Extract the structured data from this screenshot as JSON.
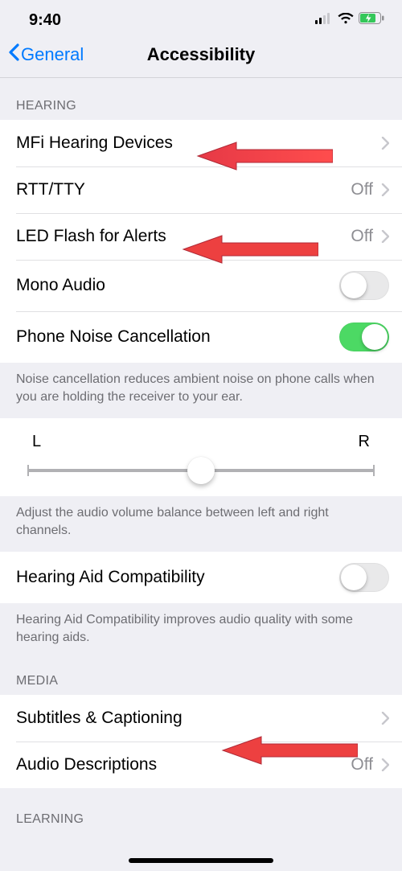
{
  "status": {
    "time": "9:40"
  },
  "nav": {
    "back": "General",
    "title": "Accessibility"
  },
  "sections": {
    "hearing_header": "HEARING",
    "media_header": "MEDIA",
    "learning_header": "LEARNING"
  },
  "rows": {
    "mfi": {
      "label": "MFi Hearing Devices"
    },
    "rtt": {
      "label": "RTT/TTY",
      "value": "Off"
    },
    "led": {
      "label": "LED Flash for Alerts",
      "value": "Off"
    },
    "mono": {
      "label": "Mono Audio"
    },
    "noise": {
      "label": "Phone Noise Cancellation"
    },
    "hac": {
      "label": "Hearing Aid Compatibility"
    },
    "subtitles": {
      "label": "Subtitles & Captioning"
    },
    "audiodesc": {
      "label": "Audio Descriptions",
      "value": "Off"
    }
  },
  "footers": {
    "noise": "Noise cancellation reduces ambient noise on phone calls when you are holding the receiver to your ear.",
    "balance": "Adjust the audio volume balance between left and right channels.",
    "hac": "Hearing Aid Compatibility improves audio quality with some hearing aids."
  },
  "slider": {
    "left": "L",
    "right": "R"
  },
  "switches": {
    "mono": false,
    "noise": true,
    "hac": false
  }
}
